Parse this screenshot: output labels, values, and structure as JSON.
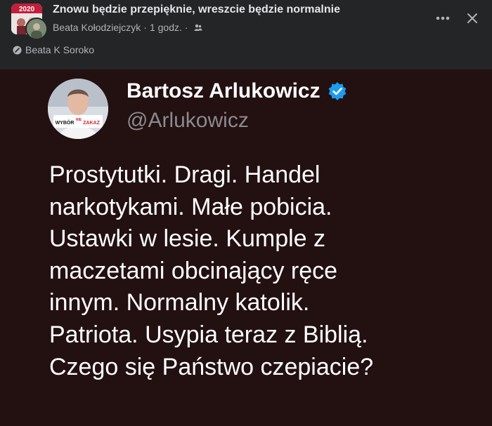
{
  "post": {
    "title": "Znowu będzie przepięknie, wreszcie będzie normalnie",
    "author": "Beata Kołodziejczyk",
    "separator": "·",
    "time": "1 godz.",
    "privacy_icon": "friends-icon",
    "more_icon": "more-icon",
    "close_icon": "close-icon",
    "tagged": "Beata K Soroko"
  },
  "tweet": {
    "name": "Bartosz Arlukowicz",
    "handle": "@Arlukowicz",
    "avatar_badge_a": "WYBÓR",
    "avatar_badge_b": "NIE",
    "avatar_badge_c": "ZAKAZ",
    "text": "Prostytutki. Dragi. Handel\nnarkotykami. Małe pobicia.\nUstawki w lesie. Kumple z\nmaczetami obcinający ręce\ninnym. Normalny katolik.\nPatriota. Usypia teraz z Biblią.\nCzego się Państwo czepiacie?"
  },
  "colors": {
    "background": "#242526",
    "image_background": "#231011",
    "primary_text": "#e4e6eb",
    "secondary_text": "#b0b3b8",
    "verified": "#1d9bf0"
  },
  "group_badge": "2020"
}
